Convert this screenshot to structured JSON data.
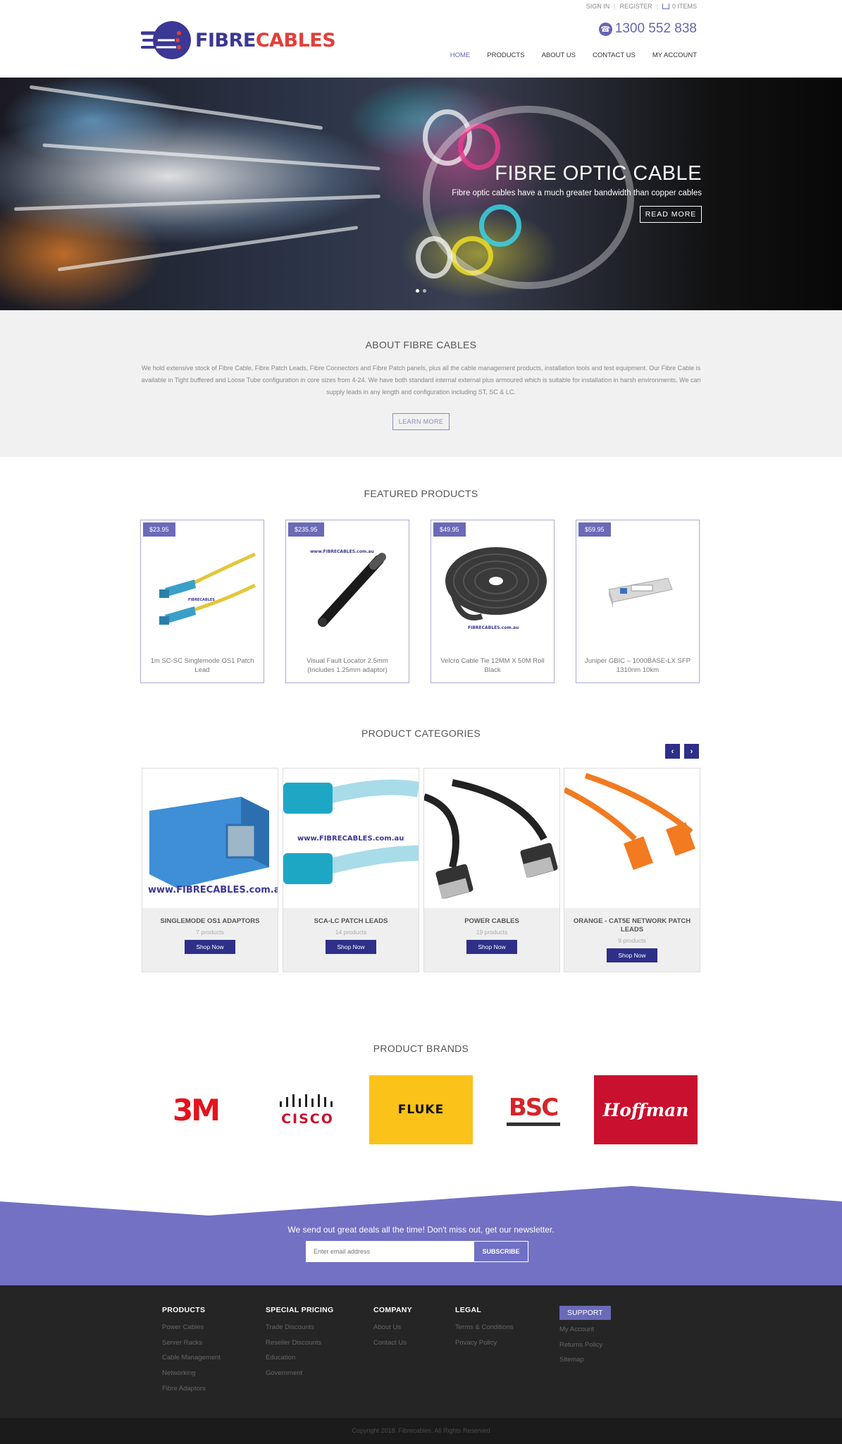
{
  "brand": {
    "name_part1": "FIBRE",
    "name_part2": "CABLES",
    "colors": {
      "primary": "#3b3896",
      "accent": "#e2403a",
      "purple": "#6a6ab8",
      "dark_button": "#2e2f88"
    }
  },
  "toplinks": {
    "sign_in": "SIGN IN",
    "register": "REGISTER",
    "cart": "0 ITEMS"
  },
  "phone": "1300 552 838",
  "nav": [
    {
      "label": "HOME"
    },
    {
      "label": "PRODUCTS"
    },
    {
      "label": "ABOUT US"
    },
    {
      "label": "CONTACT US"
    },
    {
      "label": "MY ACCOUNT"
    }
  ],
  "hero": {
    "title": "FIBRE OPTIC CABLE",
    "subtitle": "Fibre optic cables have a much greater bandwidth than copper cables",
    "button": "READ MORE"
  },
  "about": {
    "title": "ABOUT FIBRE CABLES",
    "text": "We hold extensive stock of Fibre Cable, Fibre Patch Leads, Fibre Connectors and Fibre Patch panels, plus all the cable management products, installation tools and test equipment. Our Fibre Cable is available in Tight buffered and Loose Tube configuration in core sizes from 4-24. We have both standard internal external plus armoured which is suitable for installation in harsh environments. We can supply leads in any length and configuration including ST, SC & LC.",
    "button": "LEARN MORE"
  },
  "featured": {
    "title": "FEATURED PRODUCTS",
    "products": [
      {
        "price": "$23.95",
        "name": "1m SC-SC Singlemode OS1 Patch Lead"
      },
      {
        "price": "$235.95",
        "name": "Visual Fault Locator 2.5mm (Includes 1.25mm adaptor)"
      },
      {
        "price": "$49.95",
        "name": "Velcro Cable Tie 12MM X 50M Roll Black"
      },
      {
        "price": "$59.95",
        "name": "Juniper GBIC – 1000BASE-LX SFP 1310nm 10km"
      }
    ]
  },
  "categories": {
    "title": "PRODUCT CATEGORIES",
    "items": [
      {
        "name": "SINGLEMODE OS1 ADAPTORS",
        "count": "7 products",
        "button": "Shop Now"
      },
      {
        "name": "SCA-LC PATCH LEADS",
        "count": "14 products",
        "button": "Shop Now"
      },
      {
        "name": "POWER CABLES",
        "count": "19 products",
        "button": "Shop Now"
      },
      {
        "name": "ORANGE - CAT5E NETWORK PATCH LEADS",
        "count": "9 products",
        "button": "Shop Now"
      }
    ]
  },
  "brands": {
    "title": "PRODUCT BRANDS",
    "logos": [
      "3M",
      "CISCO",
      "FLUKE",
      "BSC",
      "Hoffman"
    ]
  },
  "newsletter": {
    "text": "We send out great deals all the time! Don't miss out, get our newsletter.",
    "placeholder": "Enter email address",
    "button": "SUBSCRIBE"
  },
  "footer": {
    "columns": [
      {
        "title": "PRODUCTS",
        "links": [
          "Power Cables",
          "Server Racks",
          "Cable Management",
          "Networking",
          "Fibre Adaptors"
        ]
      },
      {
        "title": "SPECIAL PRICING",
        "links": [
          "Trade Discounts",
          "Reseller Discounts",
          "Education",
          "Government"
        ]
      },
      {
        "title": "COMPANY",
        "links": [
          "About Us",
          "Contact Us"
        ]
      },
      {
        "title": "LEGAL",
        "links": [
          "Terms & Conditions",
          "Privacy Policy"
        ]
      },
      {
        "title": "SUPPORT",
        "links": [
          "My Account",
          "Returns Policy",
          "Sitemap"
        ]
      }
    ],
    "copyright": "Copyright 2018. Fibrecables. All Rights Reserved"
  }
}
